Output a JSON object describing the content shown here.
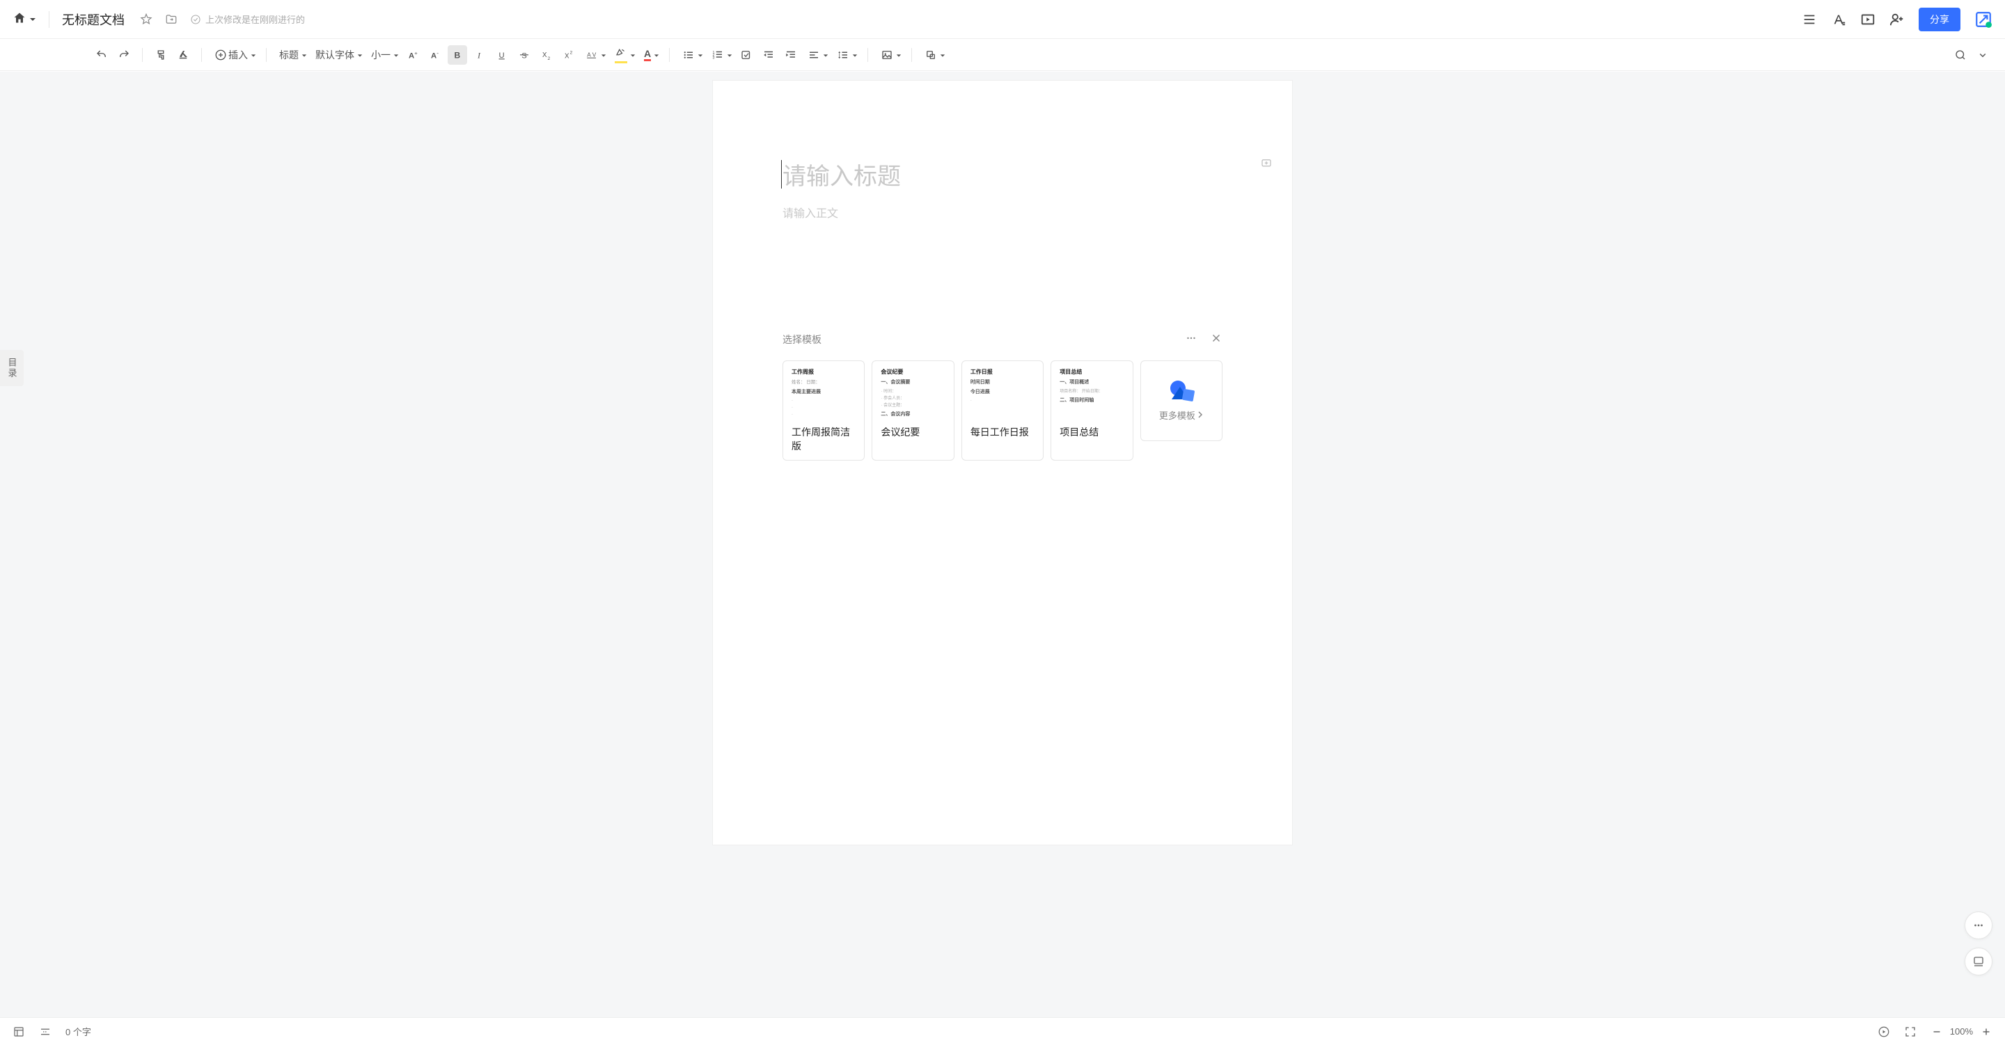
{
  "header": {
    "doc_title": "无标题文档",
    "save_status": "上次修改是在刚刚进行的",
    "share_label": "分享"
  },
  "toolbar": {
    "insert_label": "插入",
    "heading_label": "标题",
    "font_label": "默认字体",
    "size_label": "小一"
  },
  "editor": {
    "title_placeholder": "请输入标题",
    "body_placeholder": "请输入正文"
  },
  "toc": {
    "label": "目录"
  },
  "templates": {
    "panel_title": "选择模板",
    "more_label": "更多模板",
    "items": [
      {
        "label": "工作周报简洁版",
        "preview_title": "工作周报",
        "preview_sub": "姓名：  日期：",
        "preview_head": "本周主要进展",
        "preview_lines": [
          "· ",
          "· ",
          "· "
        ]
      },
      {
        "label": "会议纪要",
        "preview_title": "会议纪要",
        "preview_sub": "",
        "preview_head": "一、会议摘要",
        "preview_lines": [
          "· 时间：",
          "· 参会人员：",
          "· 会议主题：",
          "二、会议内容"
        ]
      },
      {
        "label": "每日工作日报",
        "preview_title": "工作日报",
        "preview_sub": "",
        "preview_head": "时间日期",
        "preview_lines": [
          "今日进展",
          "·"
        ]
      },
      {
        "label": "项目总结",
        "preview_title": "项目总结",
        "preview_sub": "",
        "preview_head": "一、项目概述",
        "preview_lines": [
          "项目名称：  开始日期：",
          "二、项目时间轴"
        ]
      }
    ]
  },
  "statusbar": {
    "word_count": "0 个字",
    "zoom_level": "100%"
  }
}
